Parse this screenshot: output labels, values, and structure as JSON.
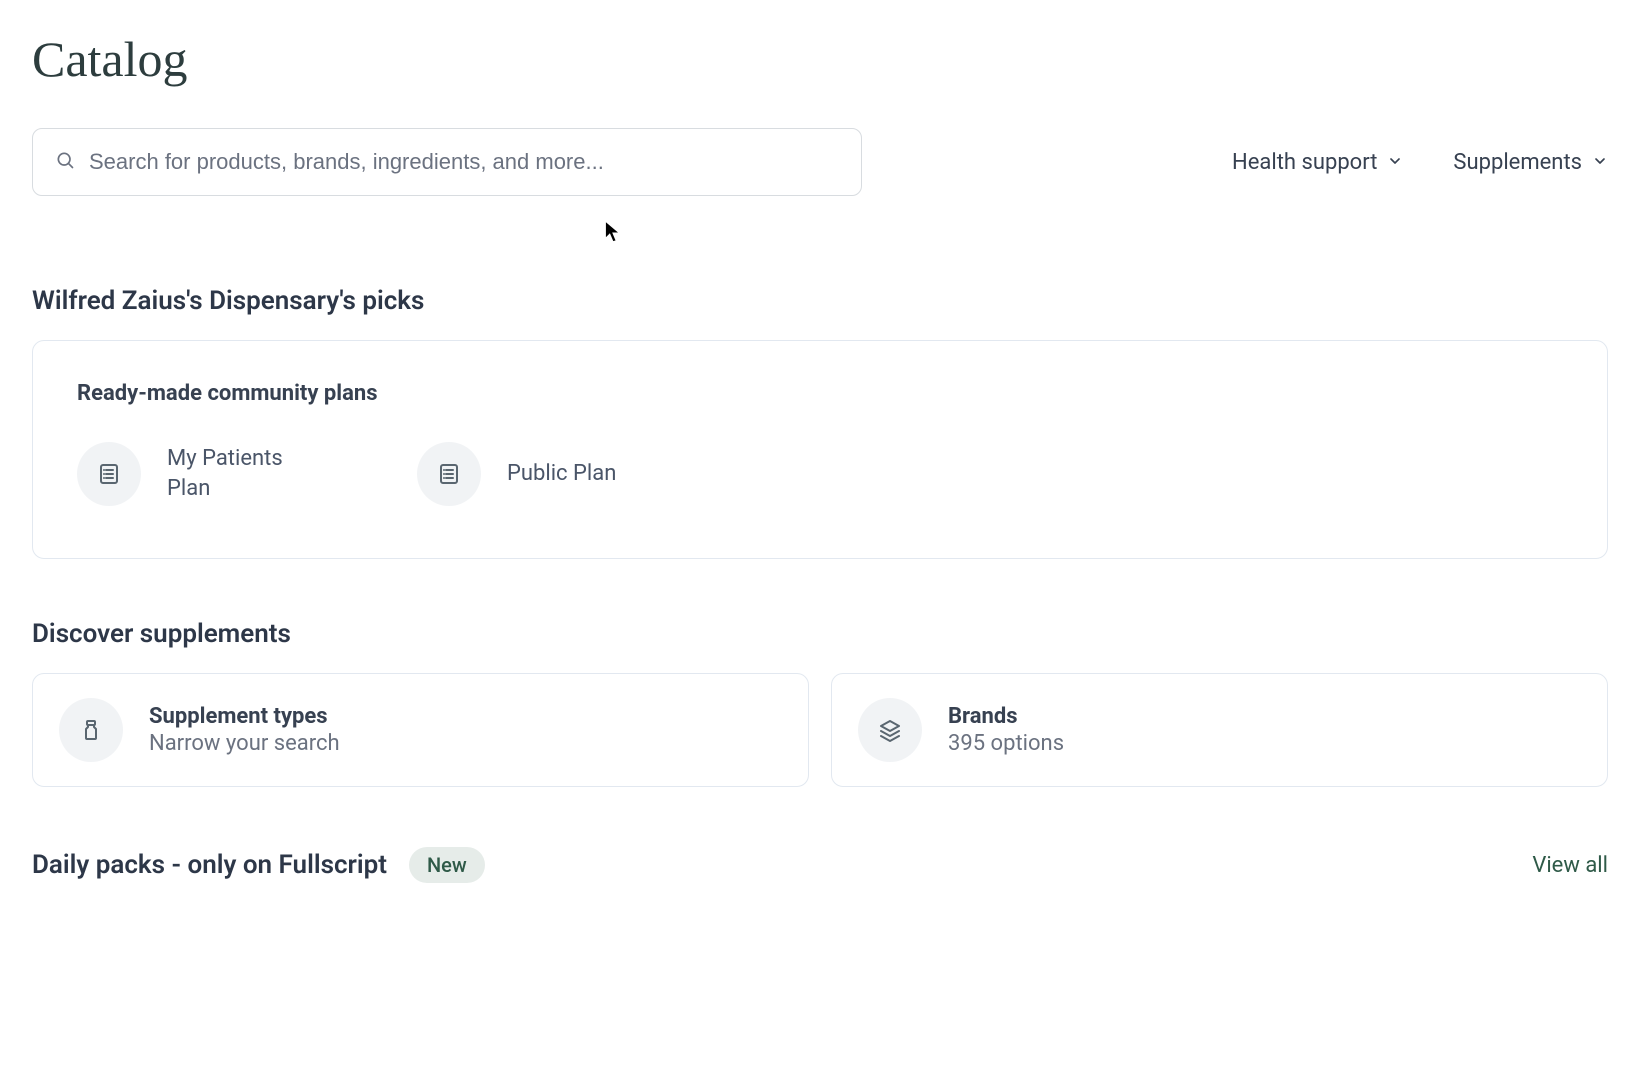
{
  "page": {
    "title": "Catalog"
  },
  "search": {
    "placeholder": "Search for products, brands, ingredients, and more..."
  },
  "filters": {
    "health_support_label": "Health support",
    "supplements_label": "Supplements"
  },
  "picks": {
    "section_title": "Wilfred Zaius's Dispensary's picks",
    "card_title": "Ready-made community plans",
    "plans": [
      {
        "label": "My Patients Plan"
      },
      {
        "label": "Public Plan"
      }
    ]
  },
  "discover": {
    "section_title": "Discover supplements",
    "cards": [
      {
        "title": "Supplement types",
        "subtitle": "Narrow your search"
      },
      {
        "title": "Brands",
        "subtitle": "395 options"
      }
    ]
  },
  "daily_packs": {
    "title": "Daily packs - only on Fullscript",
    "badge": "New",
    "view_all": "View all"
  }
}
